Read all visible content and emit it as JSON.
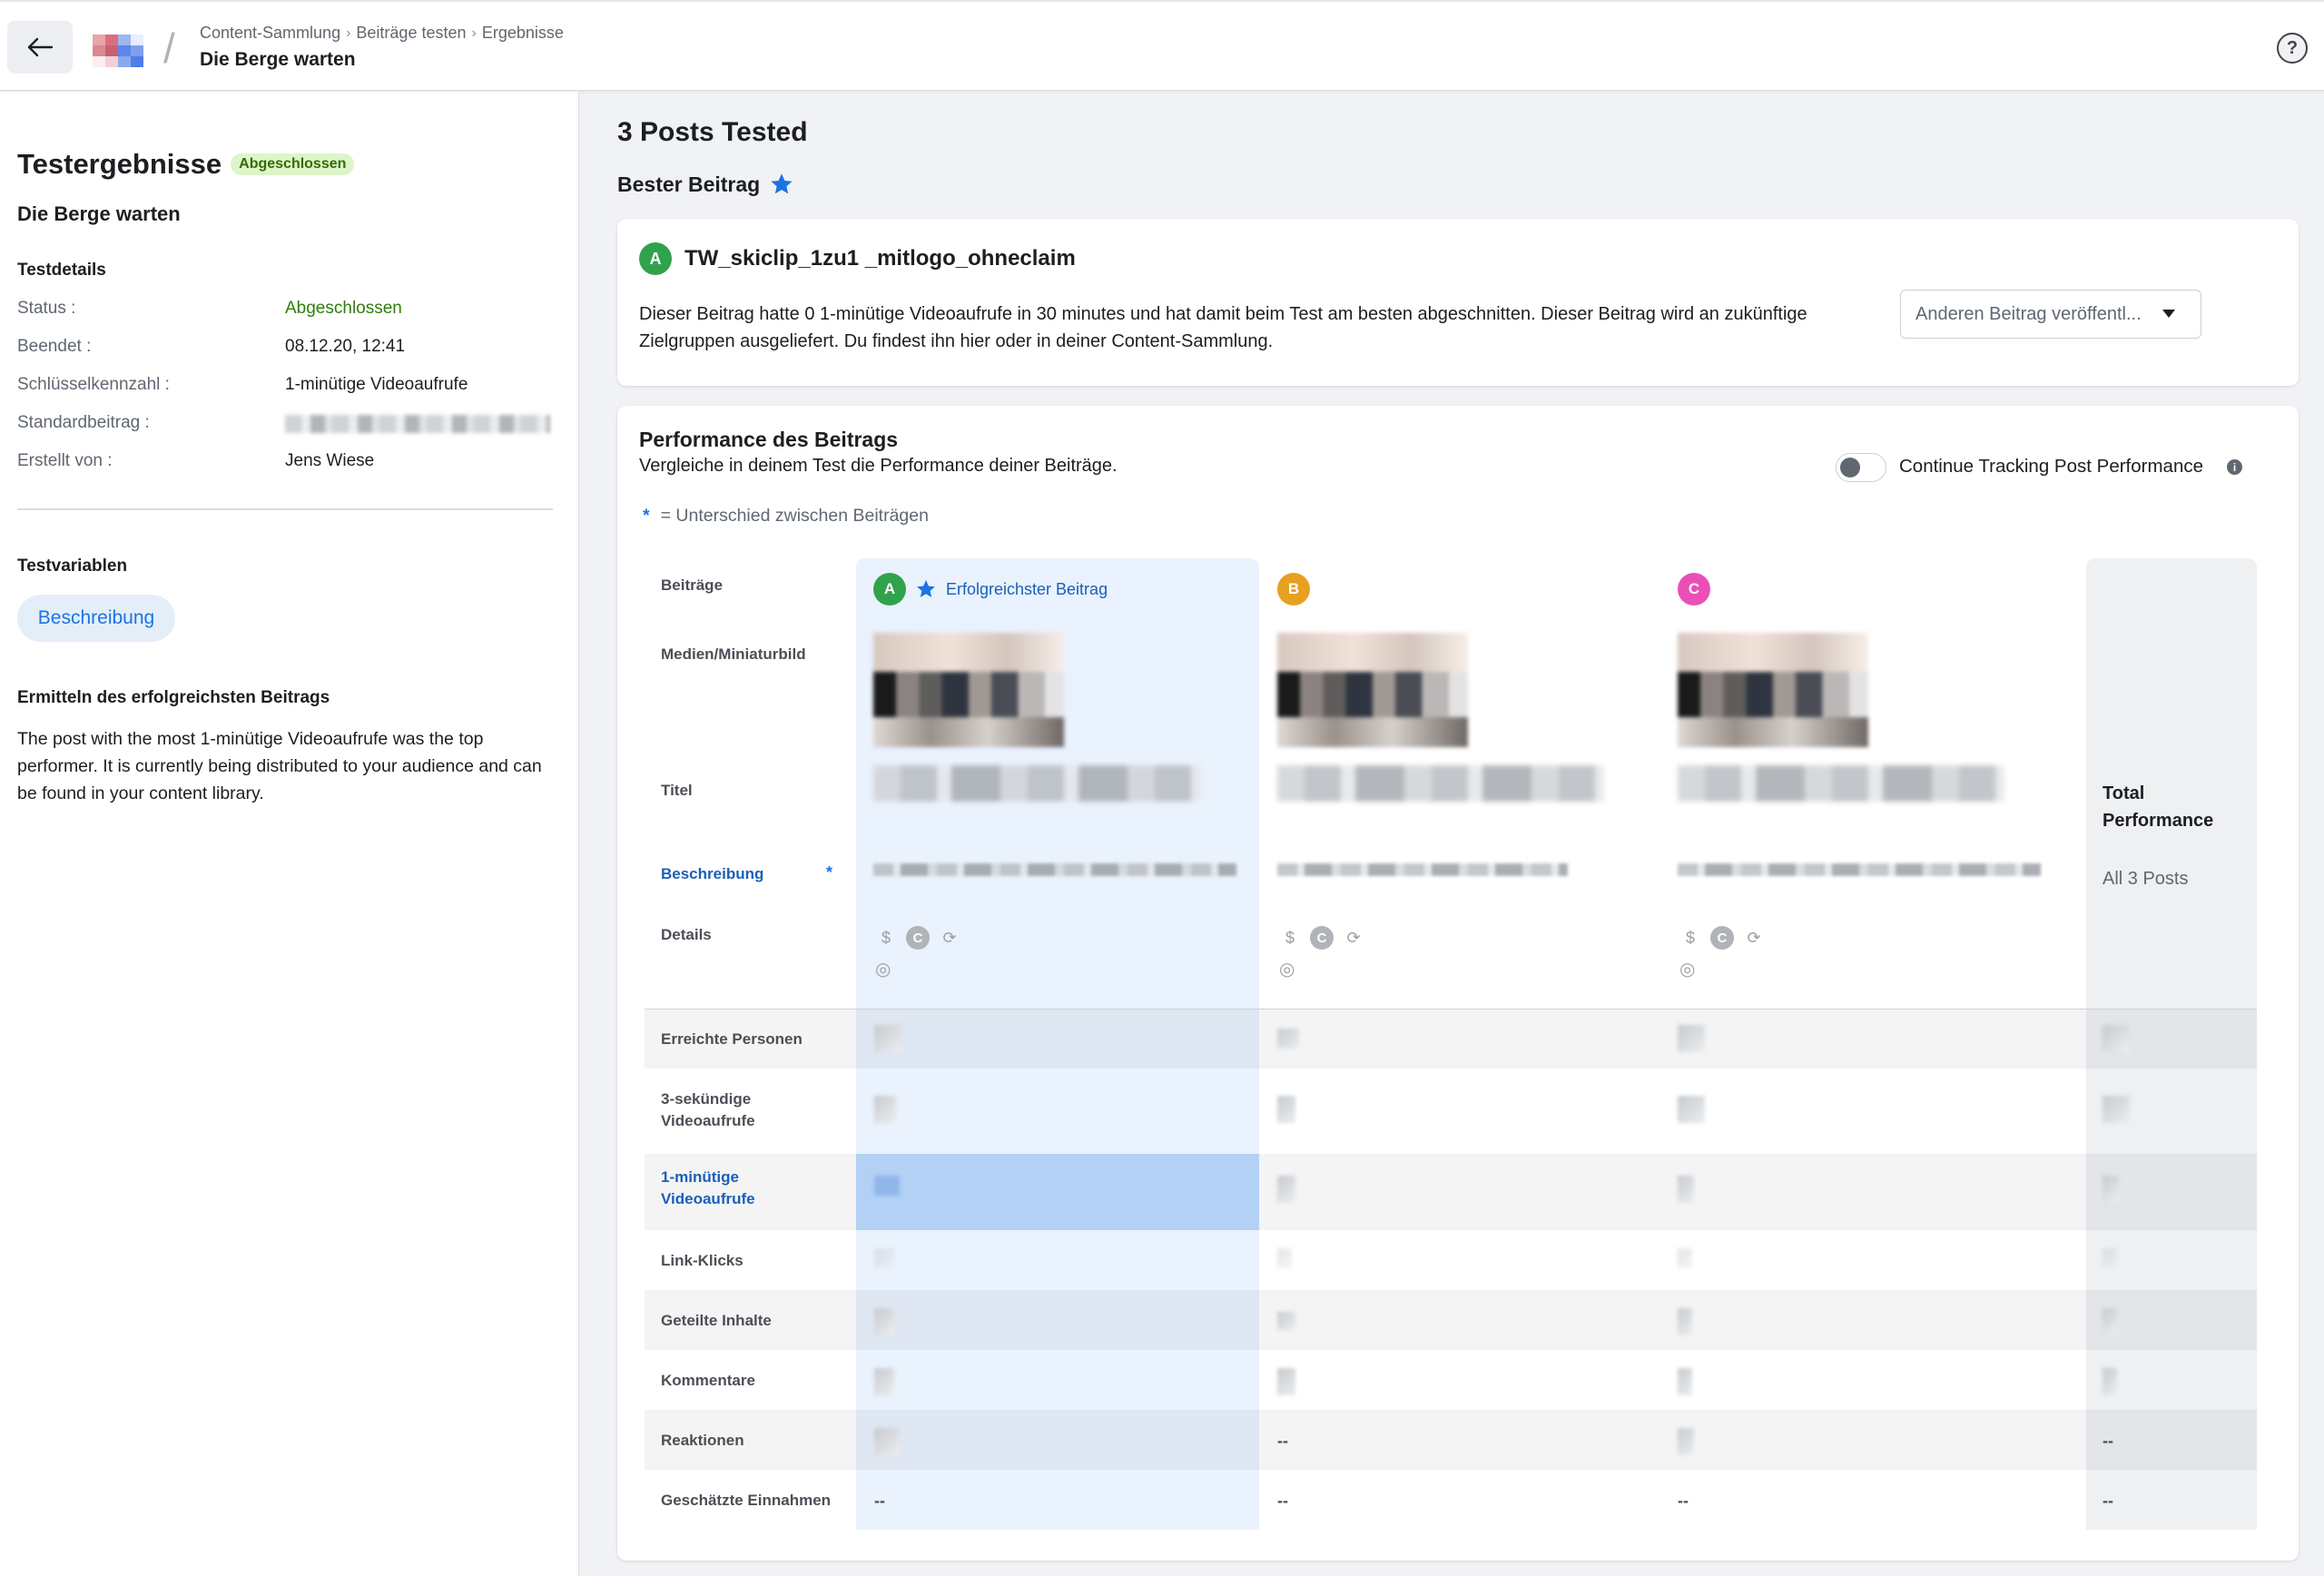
{
  "header": {
    "breadcrumbs": [
      "Content-Sammlung",
      "Beiträge testen",
      "Ergebnisse"
    ],
    "title": "Die Berge warten",
    "back_icon": "arrow-left-icon",
    "help_label": "?"
  },
  "left_panel": {
    "title": "Testergebnisse",
    "status_badge": "Abgeschlossen",
    "subtitle": "Die Berge warten",
    "testdetails_heading": "Testdetails",
    "details": [
      {
        "key": "Status :",
        "value": "Abgeschlossen"
      },
      {
        "key": "Beendet :",
        "value": "08.12.20, 12:41"
      },
      {
        "key": "Schlüsselkennzahl :",
        "value": "1-minütige Videoaufrufe"
      },
      {
        "key": "Standardbeitrag :",
        "value": ""
      },
      {
        "key": "Erstellt von :",
        "value": "Jens Wiese"
      }
    ],
    "variables_heading": "Testvariablen",
    "variable_chip": "Beschreibung",
    "winner_heading": "Ermitteln des erfolgreichsten Beitrags",
    "winner_text": "The post with the most 1-minütige Videoaufrufe was the top performer. It is currently being distributed to your audience and can be found in your content library."
  },
  "main": {
    "posts_tested": "3 Posts Tested",
    "best_label": "Bester Beitrag",
    "winner": {
      "letter": "A",
      "name": "TW_skiclip_1zu1 _mitlogo_ohneclaim",
      "text": "Dieser Beitrag hatte 0 1-minütige Videoaufrufe in 30 minutes und hat damit beim Test am besten abgeschnitten. Dieser Beitrag wird an zukünftige Zielgruppen ausgeliefert. Du findest ihn hier oder in deiner Content-Sammlung.",
      "dropdown": "Anderen Beitrag veröffentl..."
    },
    "performance": {
      "title": "Performance des Beitrags",
      "subtitle": "Vergleiche in deinem Test die Performance deiner Beiträge.",
      "toggle_label": "Continue Tracking Post Performance",
      "toggle_on": false,
      "info_icon": "i",
      "legend_star": "*",
      "legend": "= Unterschied zwischen Beiträgen",
      "row_labels": {
        "posts": "Beiträge",
        "media": "Medien/Miniaturbild",
        "title": "Titel",
        "description": "Beschreibung",
        "details": "Details"
      },
      "best_post_label": "Erfolgreichster Beitrag",
      "columns": [
        {
          "letter": "A",
          "color": "#31a24c"
        },
        {
          "letter": "B",
          "color": "#e8a021"
        },
        {
          "letter": "C",
          "color": "#ea4fb5"
        }
      ],
      "total": {
        "title": "Total Performance",
        "subtitle": "All 3 Posts"
      },
      "metrics": [
        {
          "label": "Erreichte Personen",
          "values": [
            "",
            "",
            "",
            ""
          ]
        },
        {
          "label": "3-sekündige Videoaufrufe",
          "values": [
            "",
            "",
            "",
            ""
          ]
        },
        {
          "label": "1-minütige Videoaufrufe",
          "values": [
            "",
            "",
            "",
            ""
          ]
        },
        {
          "label": "Link-Klicks",
          "values": [
            "",
            "",
            "",
            ""
          ]
        },
        {
          "label": "Geteilte Inhalte",
          "values": [
            "",
            "",
            "",
            ""
          ]
        },
        {
          "label": "Kommentare",
          "values": [
            "",
            "",
            "",
            ""
          ]
        },
        {
          "label": "Reaktionen",
          "values": [
            "",
            "--",
            "",
            "--"
          ]
        },
        {
          "label": "Geschätzte Einnahmen",
          "values": [
            "--",
            "--",
            "--",
            "--"
          ]
        }
      ]
    }
  }
}
